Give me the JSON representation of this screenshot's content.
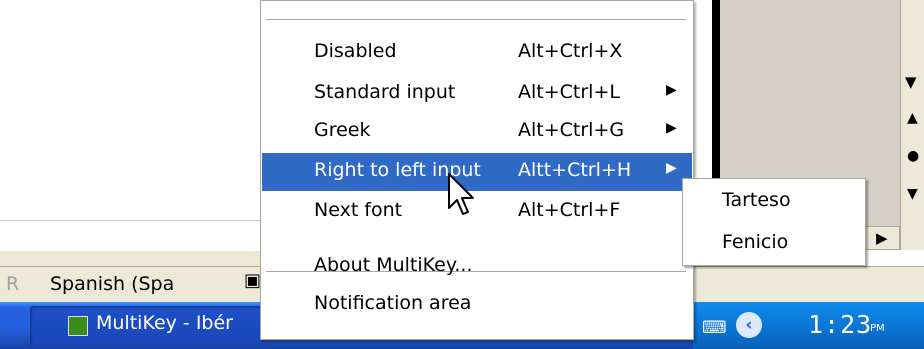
{
  "background": {
    "status_language": "Spanish (Spa",
    "status_clip_char": "R"
  },
  "menu": {
    "items": [
      {
        "label": "Disabled",
        "accel": "Alt+Ctrl+X",
        "submenu": false
      },
      {
        "label": "Standard input",
        "accel": "Alt+Ctrl+L",
        "submenu": true
      },
      {
        "label": "Greek",
        "accel": "Alt+Ctrl+G",
        "submenu": true
      },
      {
        "label": "Right to left input",
        "accel": "Altt+Ctrl+H",
        "submenu": true,
        "highlighted": true
      },
      {
        "label": "Next font",
        "accel": "Alt+Ctrl+F",
        "submenu": false
      },
      {
        "label": "About MultiKey...",
        "accel": "",
        "submenu": false
      },
      {
        "label": "Notification area",
        "accel": "",
        "submenu": false
      }
    ],
    "submenu_arrow": "▶"
  },
  "submenu": {
    "items": [
      {
        "label": "Tarteso"
      },
      {
        "label": "Fenicio"
      }
    ]
  },
  "taskbar": {
    "task_label": "MultiKey - Ibér",
    "clock": "1:23",
    "ampm": "PM"
  },
  "colors": {
    "highlight": "#316ac5",
    "taskbar_blue": "#245edc",
    "tray_blue": "#0b77d6"
  }
}
